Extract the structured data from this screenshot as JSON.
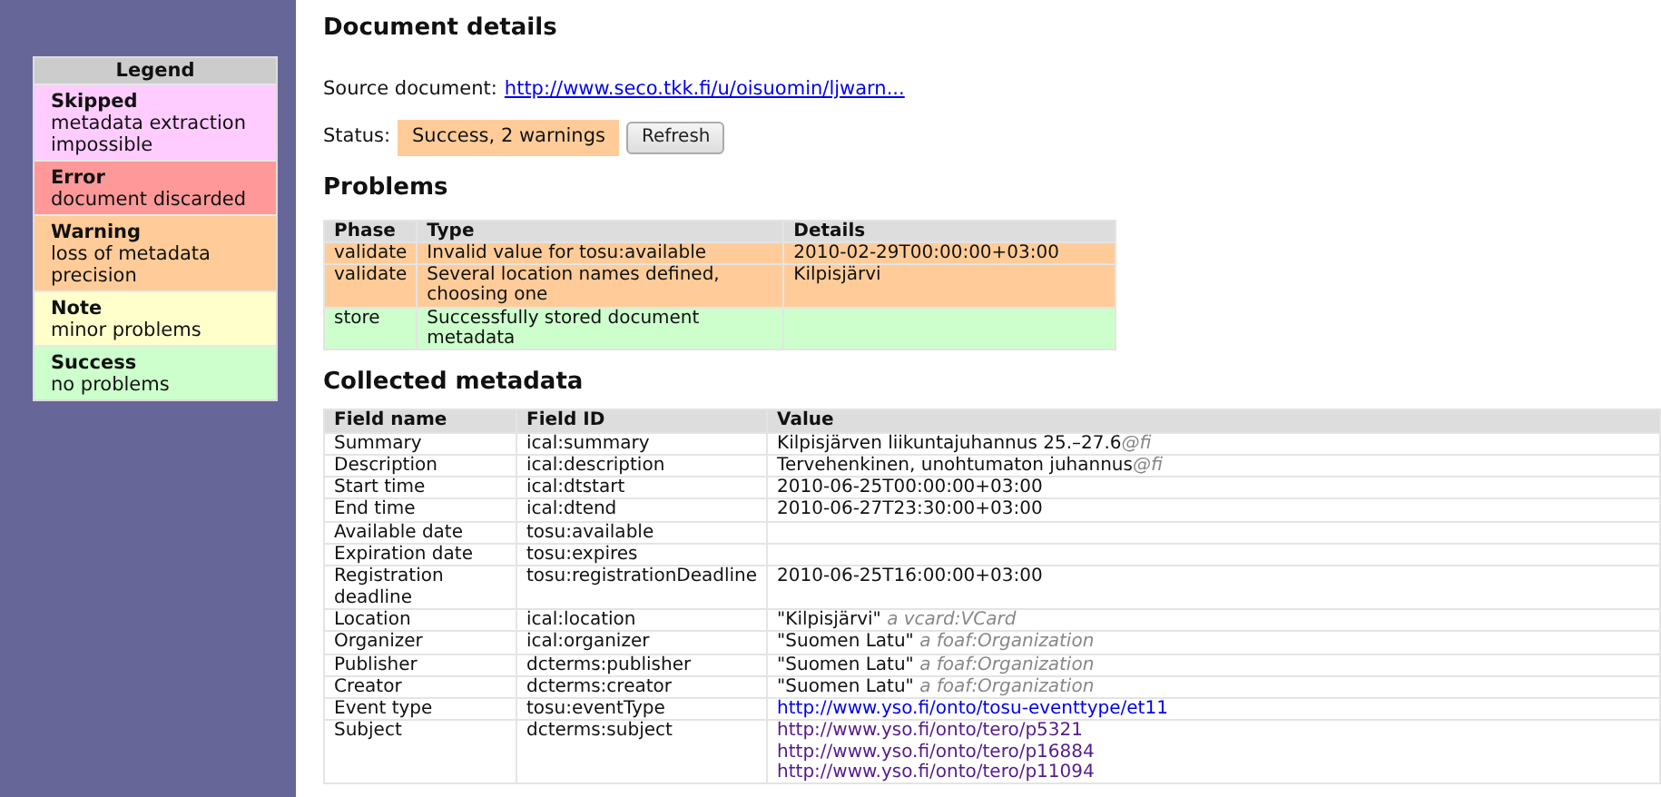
{
  "legend": {
    "title": "Legend",
    "items": [
      {
        "label": "Skipped",
        "description": "metadata extraction impossible",
        "color": "#ffccff"
      },
      {
        "label": "Error",
        "description": "document discarded",
        "color": "#ff9999"
      },
      {
        "label": "Warning",
        "description": "loss of metadata precision",
        "color": "#ffcc99"
      },
      {
        "label": "Note",
        "description": "minor problems",
        "color": "#ffffcc"
      },
      {
        "label": "Success",
        "description": "no problems",
        "color": "#ccffcc"
      }
    ]
  },
  "title": "Document details",
  "source": {
    "label": "Source document:",
    "link": "http://www.seco.tkk.fi/u/oisuomin/ljwarn..."
  },
  "status": {
    "label": "Status:",
    "value": "Success, 2 warnings",
    "color": "#ffcc99",
    "button": "Refresh"
  },
  "problems": {
    "heading": "Problems",
    "columns": [
      "Phase",
      "Type",
      "Details"
    ],
    "rows": [
      {
        "phase": "validate",
        "type": "Invalid value for tosu:available",
        "details": "2010-02-29T00:00:00+03:00",
        "color": "#ffcc99"
      },
      {
        "phase": "validate",
        "type": "Several location names defined, choosing one",
        "details": "Kilpisjärvi",
        "color": "#ffcc99"
      },
      {
        "phase": "store",
        "type": "Successfully stored document metadata",
        "color": "#ccffcc"
      }
    ]
  },
  "metadata": {
    "heading": "Collected metadata",
    "columns": [
      "Field name",
      "Field ID",
      "Value"
    ],
    "rows": [
      {
        "name": "Summary",
        "id": "ical:summary",
        "value": {
          "kind": "literal",
          "text": "Kilpisjärven liikuntajuhannus 25.–27.6",
          "lang": "@fi"
        }
      },
      {
        "name": "Description",
        "id": "ical:description",
        "value": {
          "kind": "literal",
          "text": "Tervehenkinen, unohtumaton juhannus",
          "lang": "@fi"
        }
      },
      {
        "name": "Start time",
        "id": "ical:dtstart",
        "value": {
          "kind": "text",
          "text": "2010-06-25T00:00:00+03:00"
        }
      },
      {
        "name": "End time",
        "id": "ical:dtend",
        "value": {
          "kind": "text",
          "text": "2010-06-27T23:30:00+03:00"
        }
      },
      {
        "name": "Available date",
        "id": "tosu:available"
      },
      {
        "name": "Expiration date",
        "id": "tosu:expires"
      },
      {
        "name": "Registration deadline",
        "id": "tosu:registrationDeadline",
        "value": {
          "kind": "text",
          "text": "2010-06-25T16:00:00+03:00"
        }
      },
      {
        "name": "Location",
        "id": "ical:location",
        "value": {
          "kind": "resource",
          "text": "\"Kilpisjärvi\"",
          "type": "a vcard:VCard"
        }
      },
      {
        "name": "Organizer",
        "id": "ical:organizer",
        "value": {
          "kind": "resource",
          "text": "\"Suomen Latu\"",
          "type": "a foaf:Organization"
        }
      },
      {
        "name": "Publisher",
        "id": "dcterms:publisher",
        "value": {
          "kind": "resource",
          "text": "\"Suomen Latu\"",
          "type": "a foaf:Organization"
        }
      },
      {
        "name": "Creator",
        "id": "dcterms:creator",
        "value": {
          "kind": "resource",
          "text": "\"Suomen Latu\"",
          "type": "a foaf:Organization"
        }
      },
      {
        "name": "Event type",
        "id": "tosu:eventType",
        "value": {
          "kind": "links",
          "links": [
            {
              "url": "http://www.yso.fi/onto/tosu-eventtype/et11",
              "visited": false
            }
          ]
        }
      },
      {
        "name": "Subject",
        "id": "dcterms:subject",
        "value": {
          "kind": "links",
          "links": [
            {
              "url": "http://www.yso.fi/onto/tero/p5321",
              "visited": true
            },
            {
              "url": "http://www.yso.fi/onto/tero/p16884",
              "visited": true
            },
            {
              "url": "http://www.yso.fi/onto/tero/p11094",
              "visited": true
            }
          ]
        }
      }
    ]
  }
}
